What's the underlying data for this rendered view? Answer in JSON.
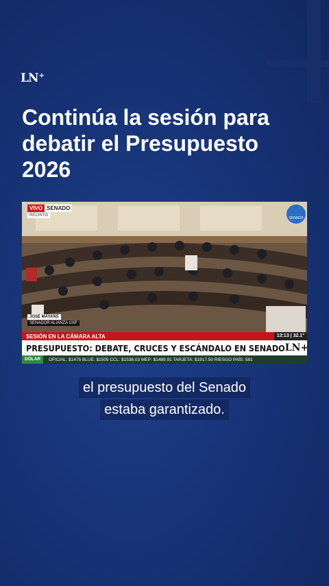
{
  "brand": {
    "logo_text": "LN",
    "logo_plus": "+"
  },
  "headline": "Continúa la sesión para debatir el Presupuesto 2026",
  "video": {
    "live_label": "VIVO",
    "channel_label": "SENADO",
    "location_label": "RECINTO",
    "senado_logo_text": "SENADO",
    "speaker_name": "JOSÉ MAYANS",
    "speaker_role": "SENADOR ALIANZA UXP",
    "ticker_top": "SESIÓN EN LA CÁMARA ALTA",
    "ticker_time": "13:13 | 32.1°",
    "ticker_headline": "PRESUPUESTO: DEBATE, CRUCES Y ESCÁNDALO EN SENADO",
    "ticker_logo": "LN+",
    "bottom_label": "DÓLAR",
    "bottom_quotes": "OFICIAL: $1475   BLUE: $1505   CCL: $1538.03   MEP: $1489.91   TARJETA: $1917.50   RIESGO PAÍS: 581"
  },
  "subtitles": [
    "el presupuesto del Senado",
    "estaba garantizado."
  ],
  "colors": {
    "background": "#173478",
    "ticker_red": "#c8141c"
  }
}
